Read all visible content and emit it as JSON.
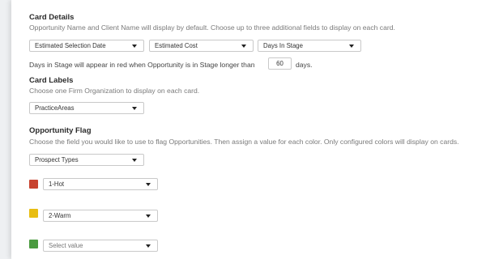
{
  "card_details": {
    "heading": "Card Details",
    "description": "Opportunity Name and Client Name will display by default. Choose up to three additional fields to display on each card.",
    "field_1": "Estimated Selection Date",
    "field_2": "Estimated Cost",
    "field_3": "Days In Stage",
    "days_text_before": "Days in Stage will appear in red when Opportunity is in Stage longer than",
    "days_value": "60",
    "days_text_after": "days."
  },
  "card_labels": {
    "heading": "Card Labels",
    "description": "Choose one Firm Organization to display on each card.",
    "selected": "PracticeAreas"
  },
  "opportunity_flag": {
    "heading": "Opportunity Flag",
    "description": "Choose the field you would like to use to flag Opportunities. Then assign a value for each color. Only configured colors will display on cards.",
    "selected_field": "Prospect Types",
    "colors": [
      {
        "color": "#c8432f",
        "value": "1-Hot"
      },
      {
        "color": "#e8bd12",
        "value": "2-Warm"
      },
      {
        "color": "#4a9a3f",
        "value": "",
        "placeholder": "Select value"
      }
    ]
  }
}
